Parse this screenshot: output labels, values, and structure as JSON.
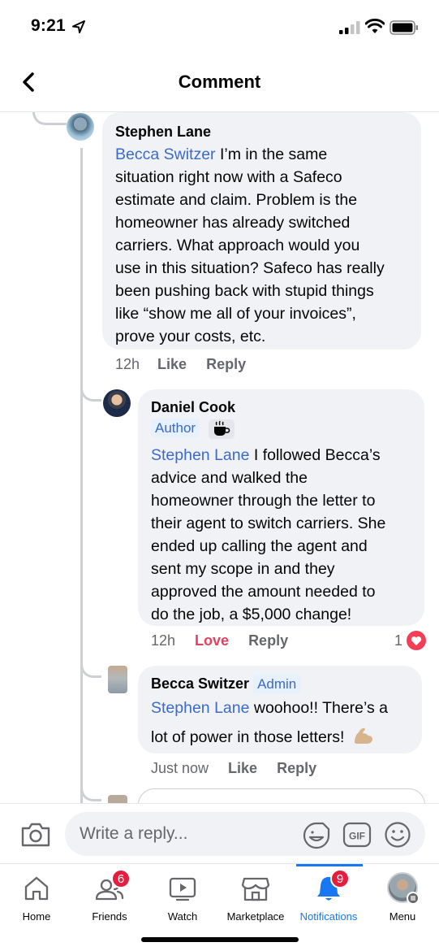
{
  "status_bar": {
    "time": "9:21"
  },
  "header": {
    "title": "Comment"
  },
  "comments": [
    {
      "author": "Stephen Lane",
      "mention": "Becca Switzer",
      "lines": [
        " I’m in the same",
        "situation right now with a Safeco",
        "estimate and claim. Problem is the",
        "homeowner has already switched",
        "carriers. What approach would you",
        "use in this situation? Safeco has really",
        "been pushing back with stupid things",
        "like “show me all of your invoices”,",
        "prove your costs, etc."
      ],
      "time": "12h",
      "like": "Like",
      "reply": "Reply"
    },
    {
      "author": "Daniel Cook",
      "badge": "Author",
      "mention": "Stephen Lane",
      "lines": [
        " I followed Becca’s",
        "advice and walked the",
        "homeowner through the letter to",
        "their agent to switch carriers. She",
        "ended up calling the agent and",
        "sent my scope in and they",
        "approved the amount needed to",
        "do the job, a $5,000 change!"
      ],
      "time": "12h",
      "like": "Love",
      "reply": "Reply",
      "reaction_count": "1",
      "reaction_color": "#f33e58"
    },
    {
      "author": "Becca Switzer",
      "badge": "Admin",
      "mention": "Stephen Lane",
      "lines": [
        " woohoo!! There’s a",
        "lot of power in those letters!"
      ],
      "time": "Just now",
      "like": "Like",
      "reply": "Reply"
    }
  ],
  "composer": {
    "placeholder": "Write a reply...",
    "gif_label": "GIF"
  },
  "tabs": [
    {
      "label": "Home",
      "icon": "home-icon"
    },
    {
      "label": "Friends",
      "icon": "friends-icon",
      "badge": "6"
    },
    {
      "label": "Watch",
      "icon": "watch-icon"
    },
    {
      "label": "Marketplace",
      "icon": "marketplace-icon"
    },
    {
      "label": "Notifications",
      "icon": "bell-icon",
      "badge": "9",
      "active": true
    },
    {
      "label": "Menu",
      "icon": "menu-avatar-icon"
    }
  ],
  "colors": {
    "accent": "#1877f2",
    "mention": "#3b6bc9",
    "love": "#e4405f",
    "badge": "#e41e3f"
  }
}
